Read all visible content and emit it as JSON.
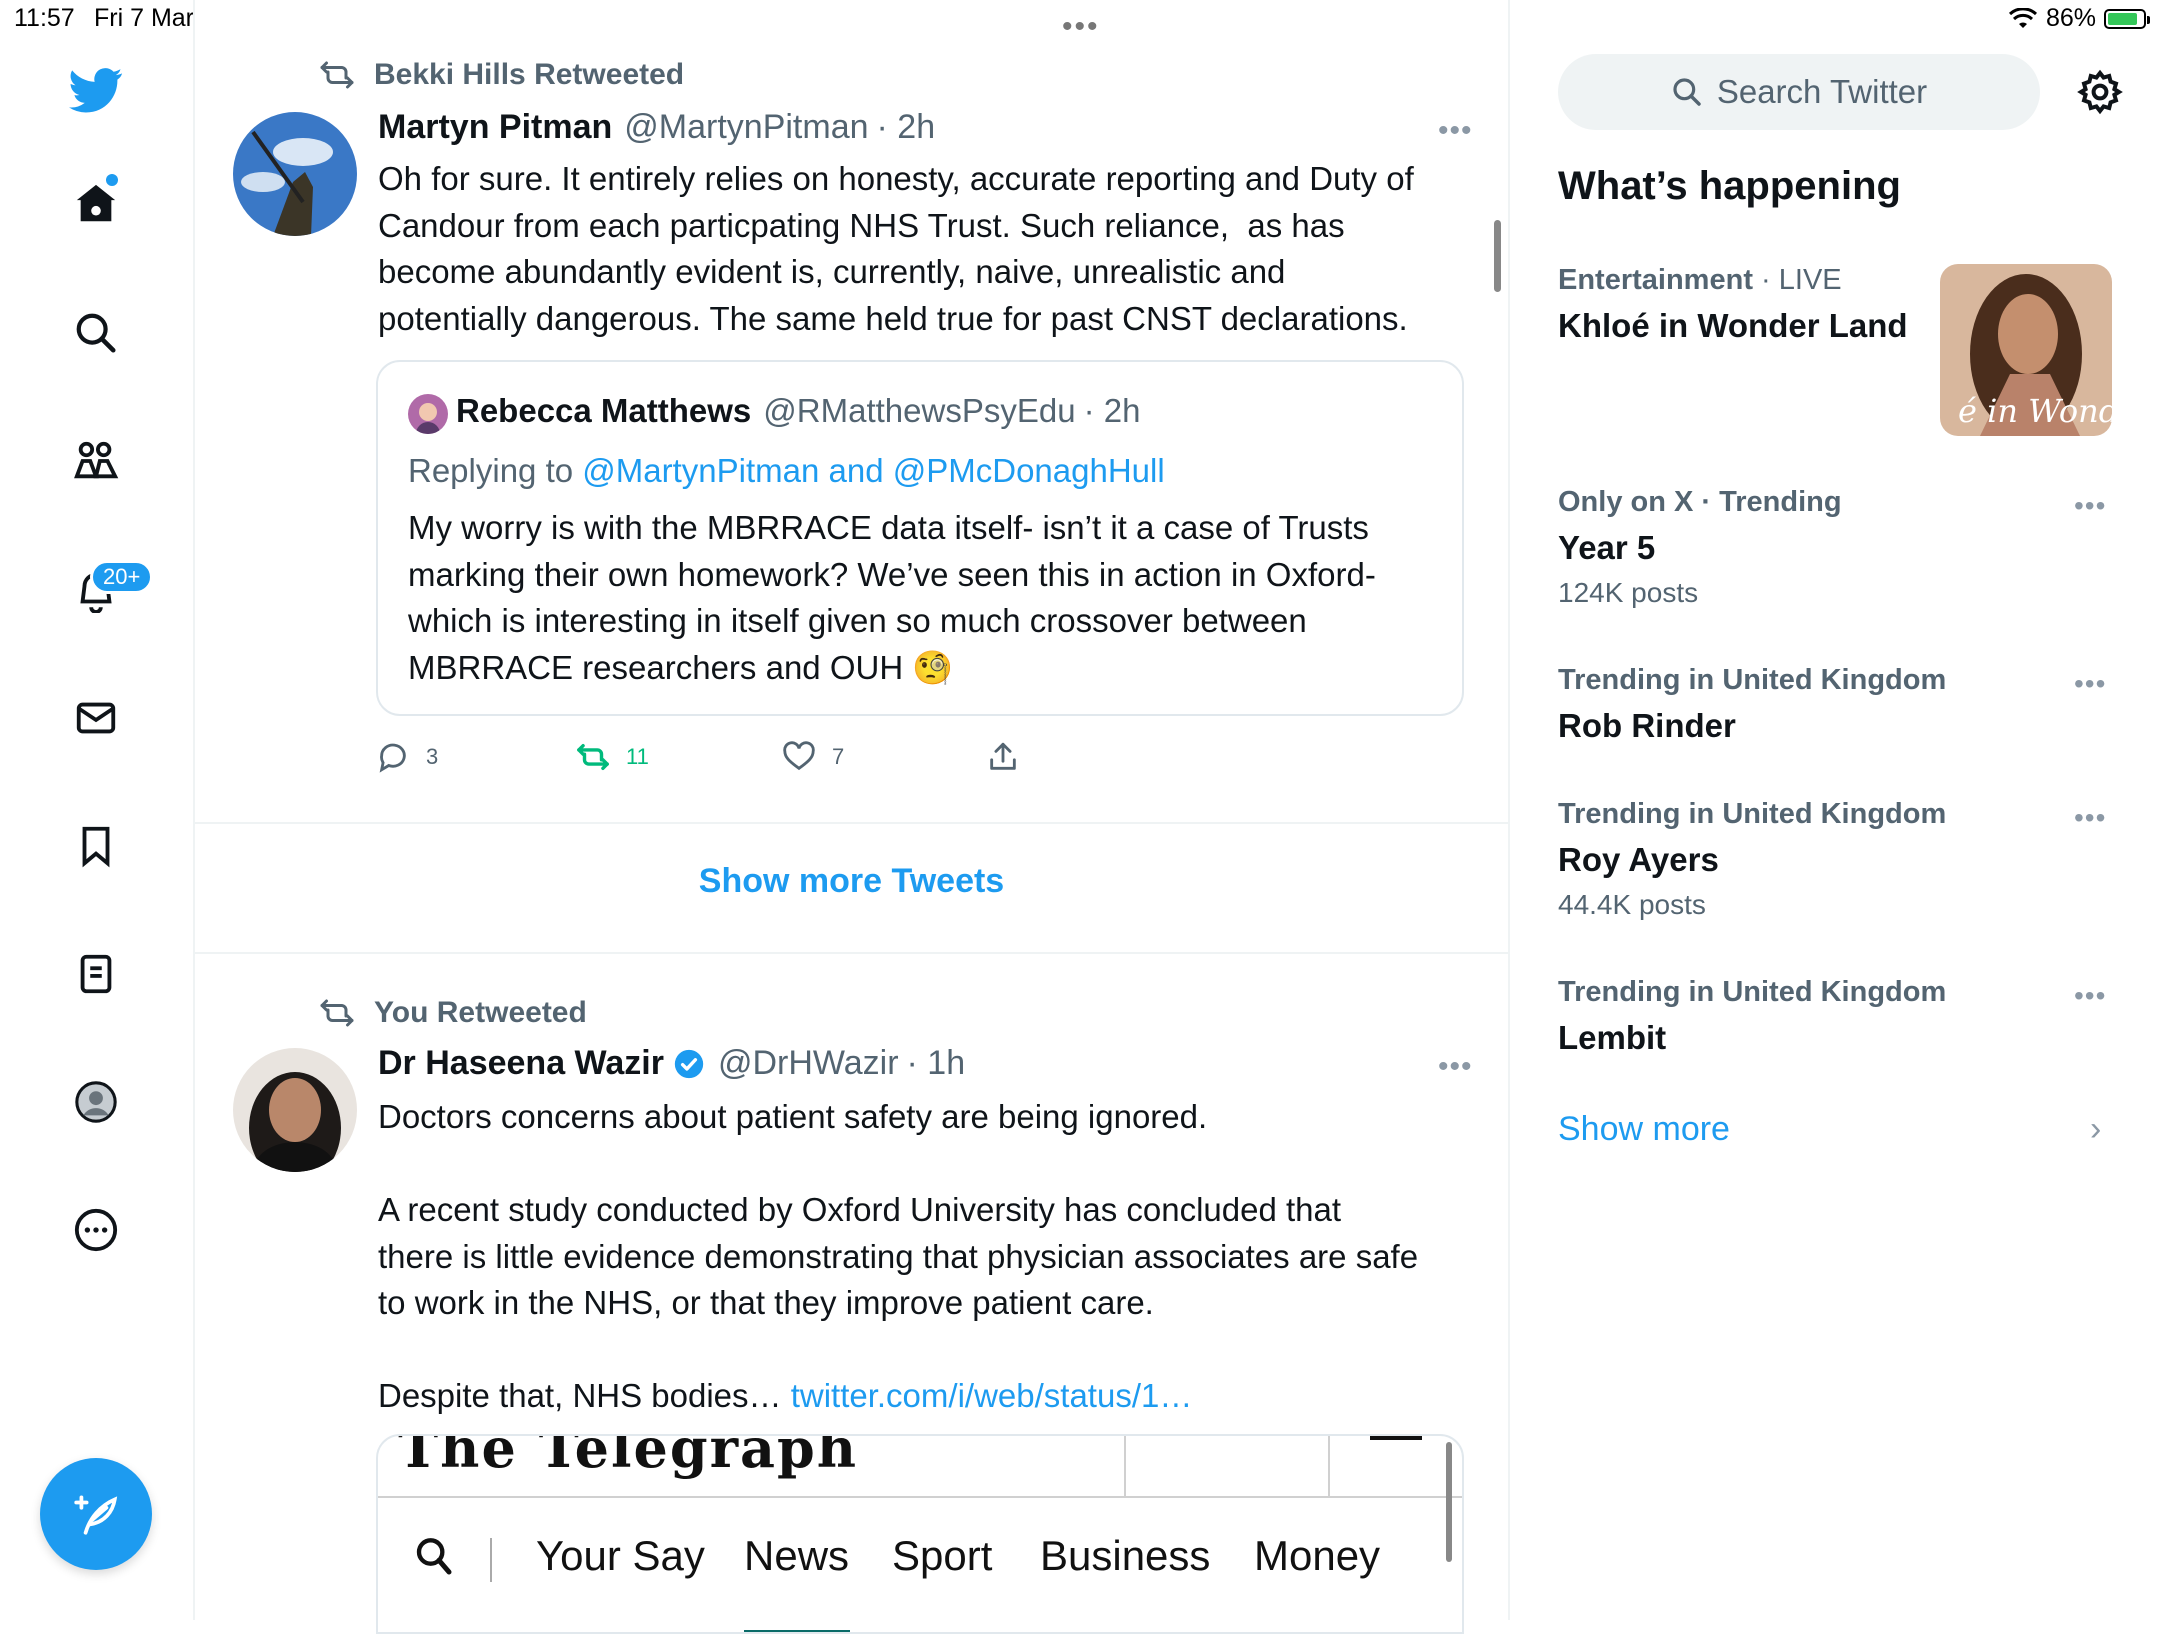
{
  "status_bar": {
    "time": "11:57",
    "date": "Fri 7 Mar",
    "battery": "86%",
    "battery_level": 0.86,
    "grabber": "•••"
  },
  "nav": {
    "notifications_badge": "20+",
    "items": [
      "twitter-logo",
      "home-icon",
      "search-icon",
      "communities-icon",
      "notifications-icon",
      "messages-icon",
      "bookmarks-icon",
      "lists-icon",
      "profile-icon",
      "more-icon"
    ],
    "accent": "#1d9bf0"
  },
  "tweet1": {
    "retweeted_by": "Bekki Hills Retweeted",
    "name": "Martyn Pitman",
    "handle": "@MartynPitman",
    "time": "· 2h",
    "more": "•••",
    "text": "Oh for sure. It entirely relies on honesty, accurate reporting and Duty of\nCandour from each particpating NHS Trust. Such reliance,  as has\nbecome abundantly evident is, currently, naive, unrealistic and\npotentially dangerous. The same held true for past CNST declarations.",
    "quote": {
      "name": "Rebecca Matthews",
      "handle": "@RMatthewsPsyEdu",
      "time": "· 2h",
      "replying_to": "Replying to",
      "replying_handles": "@MartynPitman and @PMcDonaghHull",
      "text": "My worry is with the MBRRACE data itself- isn’t it a case of Trusts\nmarking their own homework? We’ve seen this in action in Oxford-\nwhich is interesting in itself given so much crossover between\nMBRRACE researchers and OUH",
      "emoji": "🧐"
    },
    "replies": "3",
    "retweets": "11",
    "likes": "7",
    "retweet_color": "#00ba7c"
  },
  "show_more_tweets": "Show more Tweets",
  "tweet2": {
    "retweeted_by": "You Retweeted",
    "name": "Dr Haseena Wazir",
    "handle": "@DrHWazir",
    "time": "· 1h",
    "more": "•••",
    "text_p1": "Doctors concerns about patient safety are being ignored.",
    "text_p2": "A recent study conducted by Oxford University has concluded that\nthere is little evidence demonstrating that physician associates are safe\nto work in the NHS, or that they improve patient care.",
    "text_p3": "Despite that, NHS bodies…",
    "link": "twitter.com/i/web/status/1…",
    "embed": {
      "masthead": "The Telegraph",
      "nav": [
        "Your Say",
        "News",
        "Sport",
        "Business",
        "Money"
      ]
    }
  },
  "sidebar": {
    "search_placeholder": "Search Twitter",
    "title": "What’s happening",
    "trends": [
      {
        "meta": "Entertainment",
        "meta_extra": "· LIVE",
        "name": "Khloé in Wonder Land",
        "count": "",
        "image_caption": "é in Wonder l"
      },
      {
        "meta": "Only on X · Trending",
        "name": "Year 5",
        "count": "124K posts"
      },
      {
        "meta": "Trending in United Kingdom",
        "name": "Rob Rinder",
        "count": ""
      },
      {
        "meta": "Trending in United Kingdom",
        "name": "Roy Ayers",
        "count": "44.4K posts"
      },
      {
        "meta": "Trending in United Kingdom",
        "name": "Lembit",
        "count": ""
      }
    ],
    "trend_more": "•••",
    "show_more": "Show more",
    "chevron": "›"
  }
}
